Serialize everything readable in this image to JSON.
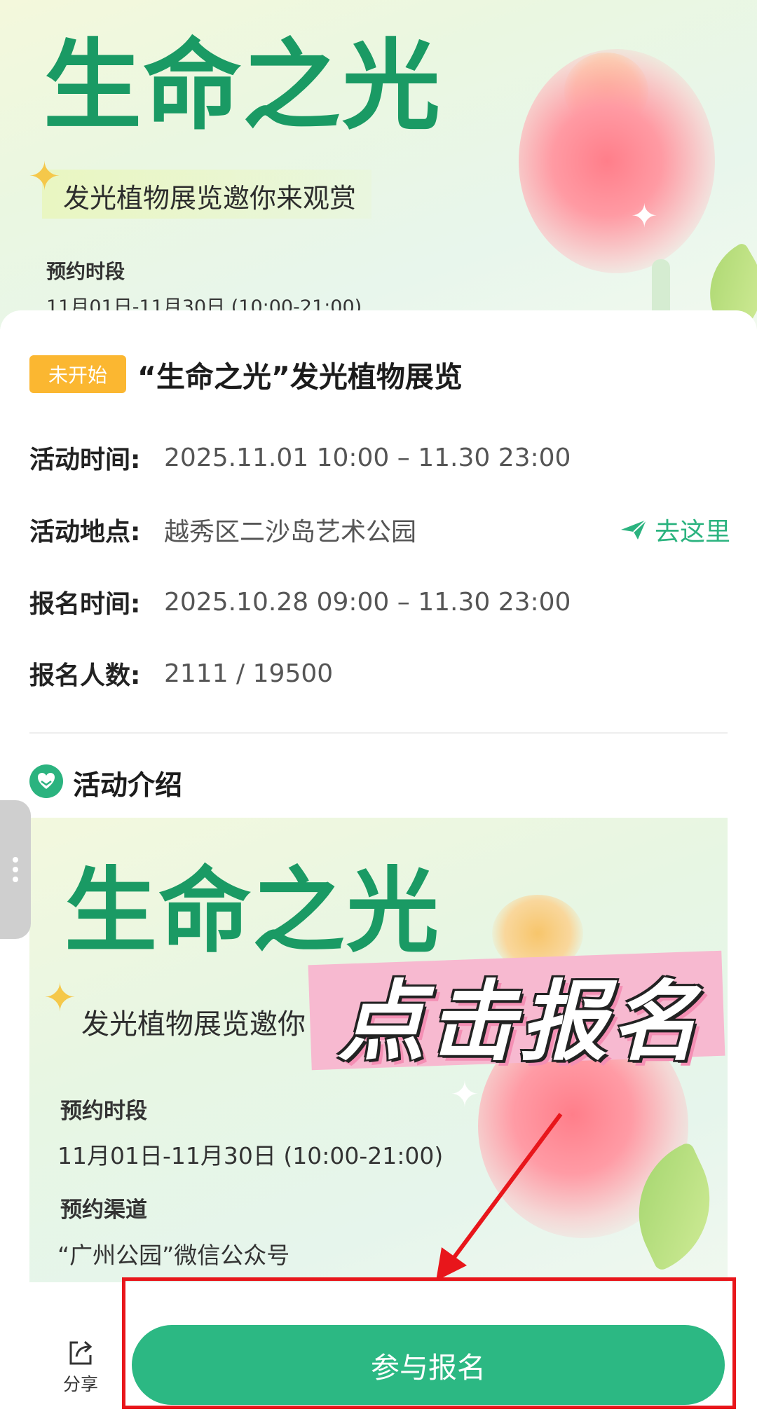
{
  "banner": {
    "title": "生命之光",
    "subtitle": "发光植物展览邀你来观赏",
    "time_label": "预约时段",
    "time_value": "11月01日-11月30日 (10:00-21:00)"
  },
  "event": {
    "status": "未开始",
    "title": "“生命之光”发光植物展览",
    "rows": [
      {
        "label": "活动时间:",
        "value": "2025.11.01 10:00 – 11.30 23:00"
      },
      {
        "label": "活动地点:",
        "value": "越秀区二沙岛艺术公园"
      },
      {
        "label": "报名时间:",
        "value": "2025.10.28 09:00 – 11.30 23:00"
      },
      {
        "label": "报名人数:",
        "value": "2111 / 19500"
      }
    ],
    "nav_label": "去这里"
  },
  "intro": {
    "title": "活动介绍",
    "poster": {
      "title": "生命之光",
      "subtitle": "发光植物展览邀你",
      "stamp": "点击报名",
      "time_label": "预约时段",
      "time_value": "11月01日-11月30日 (10:00-21:00)",
      "channel_label": "预约渠道",
      "channel_value": "“广州公园”微信公众号"
    }
  },
  "bottom_bar": {
    "share_label": "分享",
    "join_label": "参与报名"
  },
  "colors": {
    "accent": "#2cb883",
    "badge": "#fbb731",
    "annotation": "#e8161b"
  },
  "icons": [
    "share-icon",
    "navigate-icon",
    "intro-section-icon",
    "more-vertical-icon",
    "sparkle-icon"
  ]
}
